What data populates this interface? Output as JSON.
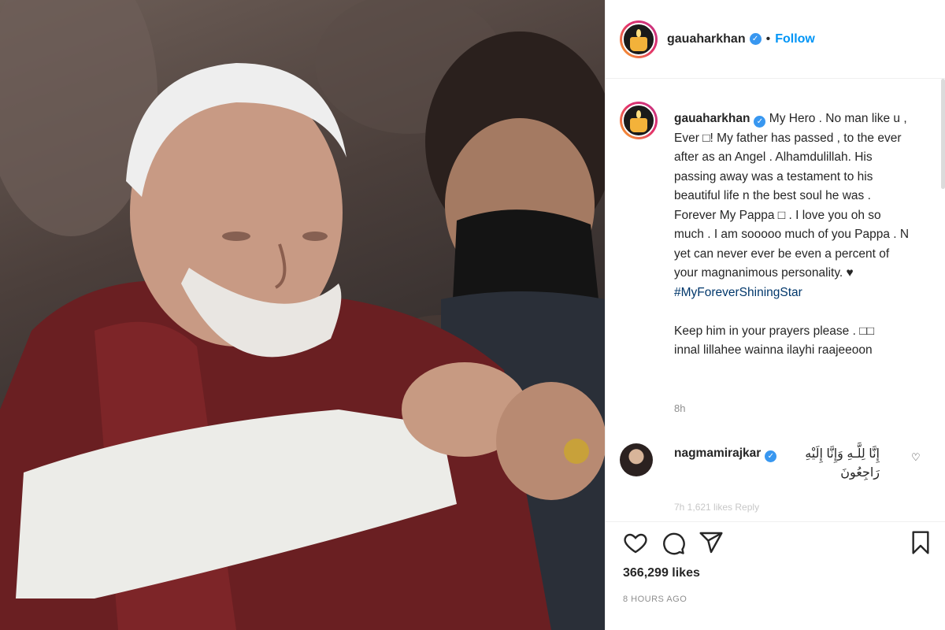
{
  "header": {
    "username": "gauaharkhan",
    "verified_icon": "verified-badge-icon",
    "separator": "•",
    "follow_label": "Follow"
  },
  "caption": {
    "username": "gauaharkhan",
    "text_parts": [
      "My Hero . No man like u , Ever □! My father has passed , to the ever after as an Angel . Alhamdulillah. His passing away was a testament to his beautiful life n the best soul he was . Forever My Pappa □ . I love you oh so much . I am sooooo much of you Pappa . N yet can never ever be even a percent of your magnanimous personality. ♥",
      "#MyForeverShiningStar",
      "Keep him in your prayers please . □□",
      "innal lillahee wainna ilayhi raajeeoon"
    ],
    "time": "8h"
  },
  "comment": {
    "username": "nagmamirajkar",
    "text": "إِنَّا لِلَّـهِ وَإِنَّا إِلَيْهِ رَاجِعُونَ",
    "heart_icon": "heart-outline-icon",
    "meta": "7h  1,621 likes  Reply"
  },
  "actions": {
    "like_icon": "heart-icon",
    "comment_icon": "comment-icon",
    "share_icon": "share-icon",
    "save_icon": "bookmark-icon",
    "likes": "366,299 likes",
    "posted": "8 HOURS AGO"
  },
  "colors": {
    "accent": "#0095f6",
    "verified": "#3897f0",
    "hashtag": "#00376b",
    "muted": "#8e8e8e"
  }
}
